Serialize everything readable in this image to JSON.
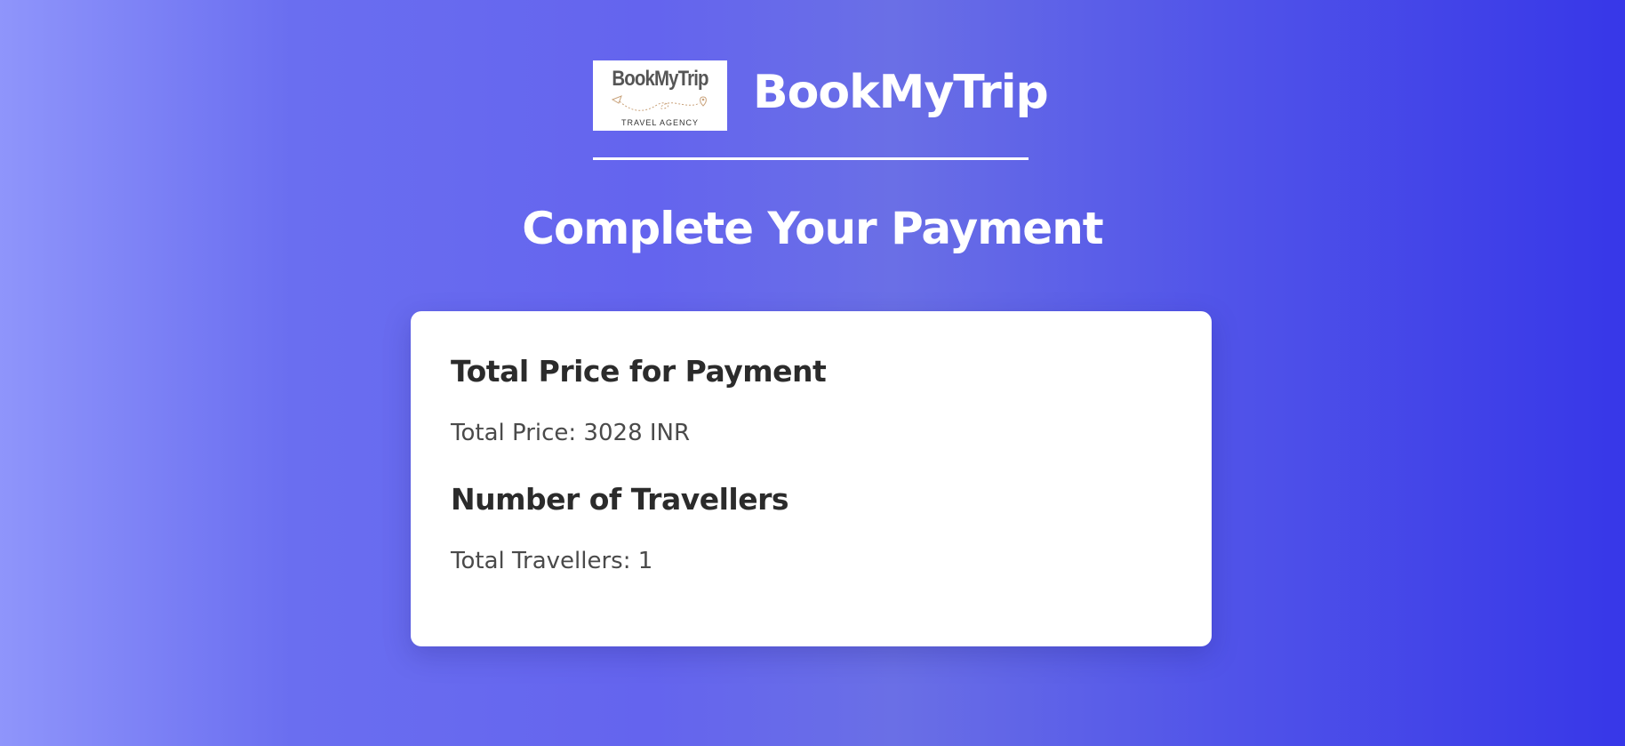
{
  "brand": {
    "logo": {
      "wordmark": "BookMyTrip",
      "tagline": "TRAVEL AGENCY"
    },
    "name": "BookMyTrip"
  },
  "page": {
    "title": "Complete Your Payment"
  },
  "payment_card": {
    "price_section": {
      "heading": "Total Price for Payment",
      "text": "Total Price: 3028 INR"
    },
    "travellers_section": {
      "heading": "Number of Travellers",
      "text": "Total Travellers: 1"
    }
  },
  "colors": {
    "background_start": "#8f95fb",
    "background_end": "#3737e8",
    "card_background": "#ffffff",
    "heading_text": "#2b2b2b",
    "body_text": "#4a4a4a"
  },
  "icons": {
    "logo_decoration": "paper-plane-path-icon"
  }
}
